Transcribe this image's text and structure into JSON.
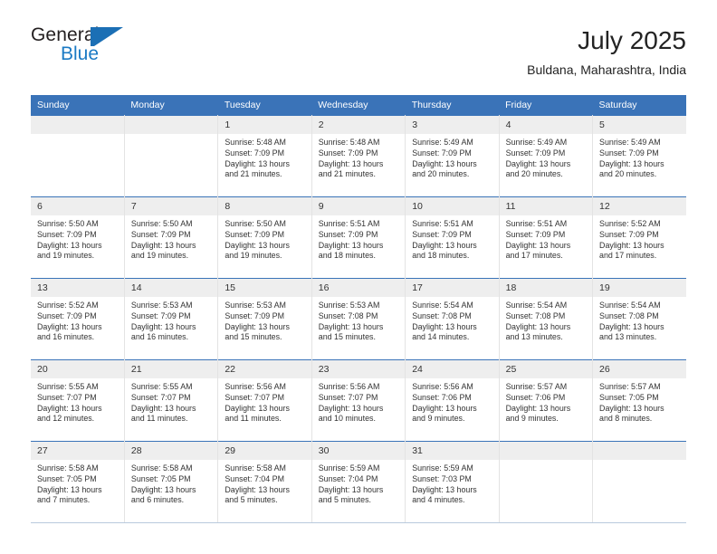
{
  "brand": {
    "line1": "General",
    "line2": "Blue",
    "flag_icon": "general-blue-flag-icon",
    "color_dark": "#1b6fb5",
    "color_light": "#1b7ac4"
  },
  "header": {
    "title": "July 2025",
    "subtitle": "Buldana, Maharashtra, India"
  },
  "theme": {
    "header_blue": "#3a73b8",
    "row_divider": "#3a73b8",
    "daynum_bg": "#eeeeee",
    "text": "#333333"
  },
  "weekdays": [
    "Sunday",
    "Monday",
    "Tuesday",
    "Wednesday",
    "Thursday",
    "Friday",
    "Saturday"
  ],
  "weeks": [
    [
      {
        "day": "",
        "sunrise": "",
        "sunset": "",
        "daylight1": "",
        "daylight2": ""
      },
      {
        "day": "",
        "sunrise": "",
        "sunset": "",
        "daylight1": "",
        "daylight2": ""
      },
      {
        "day": "1",
        "sunrise": "Sunrise: 5:48 AM",
        "sunset": "Sunset: 7:09 PM",
        "daylight1": "Daylight: 13 hours",
        "daylight2": "and 21 minutes."
      },
      {
        "day": "2",
        "sunrise": "Sunrise: 5:48 AM",
        "sunset": "Sunset: 7:09 PM",
        "daylight1": "Daylight: 13 hours",
        "daylight2": "and 21 minutes."
      },
      {
        "day": "3",
        "sunrise": "Sunrise: 5:49 AM",
        "sunset": "Sunset: 7:09 PM",
        "daylight1": "Daylight: 13 hours",
        "daylight2": "and 20 minutes."
      },
      {
        "day": "4",
        "sunrise": "Sunrise: 5:49 AM",
        "sunset": "Sunset: 7:09 PM",
        "daylight1": "Daylight: 13 hours",
        "daylight2": "and 20 minutes."
      },
      {
        "day": "5",
        "sunrise": "Sunrise: 5:49 AM",
        "sunset": "Sunset: 7:09 PM",
        "daylight1": "Daylight: 13 hours",
        "daylight2": "and 20 minutes."
      }
    ],
    [
      {
        "day": "6",
        "sunrise": "Sunrise: 5:50 AM",
        "sunset": "Sunset: 7:09 PM",
        "daylight1": "Daylight: 13 hours",
        "daylight2": "and 19 minutes."
      },
      {
        "day": "7",
        "sunrise": "Sunrise: 5:50 AM",
        "sunset": "Sunset: 7:09 PM",
        "daylight1": "Daylight: 13 hours",
        "daylight2": "and 19 minutes."
      },
      {
        "day": "8",
        "sunrise": "Sunrise: 5:50 AM",
        "sunset": "Sunset: 7:09 PM",
        "daylight1": "Daylight: 13 hours",
        "daylight2": "and 19 minutes."
      },
      {
        "day": "9",
        "sunrise": "Sunrise: 5:51 AM",
        "sunset": "Sunset: 7:09 PM",
        "daylight1": "Daylight: 13 hours",
        "daylight2": "and 18 minutes."
      },
      {
        "day": "10",
        "sunrise": "Sunrise: 5:51 AM",
        "sunset": "Sunset: 7:09 PM",
        "daylight1": "Daylight: 13 hours",
        "daylight2": "and 18 minutes."
      },
      {
        "day": "11",
        "sunrise": "Sunrise: 5:51 AM",
        "sunset": "Sunset: 7:09 PM",
        "daylight1": "Daylight: 13 hours",
        "daylight2": "and 17 minutes."
      },
      {
        "day": "12",
        "sunrise": "Sunrise: 5:52 AM",
        "sunset": "Sunset: 7:09 PM",
        "daylight1": "Daylight: 13 hours",
        "daylight2": "and 17 minutes."
      }
    ],
    [
      {
        "day": "13",
        "sunrise": "Sunrise: 5:52 AM",
        "sunset": "Sunset: 7:09 PM",
        "daylight1": "Daylight: 13 hours",
        "daylight2": "and 16 minutes."
      },
      {
        "day": "14",
        "sunrise": "Sunrise: 5:53 AM",
        "sunset": "Sunset: 7:09 PM",
        "daylight1": "Daylight: 13 hours",
        "daylight2": "and 16 minutes."
      },
      {
        "day": "15",
        "sunrise": "Sunrise: 5:53 AM",
        "sunset": "Sunset: 7:09 PM",
        "daylight1": "Daylight: 13 hours",
        "daylight2": "and 15 minutes."
      },
      {
        "day": "16",
        "sunrise": "Sunrise: 5:53 AM",
        "sunset": "Sunset: 7:08 PM",
        "daylight1": "Daylight: 13 hours",
        "daylight2": "and 15 minutes."
      },
      {
        "day": "17",
        "sunrise": "Sunrise: 5:54 AM",
        "sunset": "Sunset: 7:08 PM",
        "daylight1": "Daylight: 13 hours",
        "daylight2": "and 14 minutes."
      },
      {
        "day": "18",
        "sunrise": "Sunrise: 5:54 AM",
        "sunset": "Sunset: 7:08 PM",
        "daylight1": "Daylight: 13 hours",
        "daylight2": "and 13 minutes."
      },
      {
        "day": "19",
        "sunrise": "Sunrise: 5:54 AM",
        "sunset": "Sunset: 7:08 PM",
        "daylight1": "Daylight: 13 hours",
        "daylight2": "and 13 minutes."
      }
    ],
    [
      {
        "day": "20",
        "sunrise": "Sunrise: 5:55 AM",
        "sunset": "Sunset: 7:07 PM",
        "daylight1": "Daylight: 13 hours",
        "daylight2": "and 12 minutes."
      },
      {
        "day": "21",
        "sunrise": "Sunrise: 5:55 AM",
        "sunset": "Sunset: 7:07 PM",
        "daylight1": "Daylight: 13 hours",
        "daylight2": "and 11 minutes."
      },
      {
        "day": "22",
        "sunrise": "Sunrise: 5:56 AM",
        "sunset": "Sunset: 7:07 PM",
        "daylight1": "Daylight: 13 hours",
        "daylight2": "and 11 minutes."
      },
      {
        "day": "23",
        "sunrise": "Sunrise: 5:56 AM",
        "sunset": "Sunset: 7:07 PM",
        "daylight1": "Daylight: 13 hours",
        "daylight2": "and 10 minutes."
      },
      {
        "day": "24",
        "sunrise": "Sunrise: 5:56 AM",
        "sunset": "Sunset: 7:06 PM",
        "daylight1": "Daylight: 13 hours",
        "daylight2": "and 9 minutes."
      },
      {
        "day": "25",
        "sunrise": "Sunrise: 5:57 AM",
        "sunset": "Sunset: 7:06 PM",
        "daylight1": "Daylight: 13 hours",
        "daylight2": "and 9 minutes."
      },
      {
        "day": "26",
        "sunrise": "Sunrise: 5:57 AM",
        "sunset": "Sunset: 7:05 PM",
        "daylight1": "Daylight: 13 hours",
        "daylight2": "and 8 minutes."
      }
    ],
    [
      {
        "day": "27",
        "sunrise": "Sunrise: 5:58 AM",
        "sunset": "Sunset: 7:05 PM",
        "daylight1": "Daylight: 13 hours",
        "daylight2": "and 7 minutes."
      },
      {
        "day": "28",
        "sunrise": "Sunrise: 5:58 AM",
        "sunset": "Sunset: 7:05 PM",
        "daylight1": "Daylight: 13 hours",
        "daylight2": "and 6 minutes."
      },
      {
        "day": "29",
        "sunrise": "Sunrise: 5:58 AM",
        "sunset": "Sunset: 7:04 PM",
        "daylight1": "Daylight: 13 hours",
        "daylight2": "and 5 minutes."
      },
      {
        "day": "30",
        "sunrise": "Sunrise: 5:59 AM",
        "sunset": "Sunset: 7:04 PM",
        "daylight1": "Daylight: 13 hours",
        "daylight2": "and 5 minutes."
      },
      {
        "day": "31",
        "sunrise": "Sunrise: 5:59 AM",
        "sunset": "Sunset: 7:03 PM",
        "daylight1": "Daylight: 13 hours",
        "daylight2": "and 4 minutes."
      },
      {
        "day": "",
        "sunrise": "",
        "sunset": "",
        "daylight1": "",
        "daylight2": ""
      },
      {
        "day": "",
        "sunrise": "",
        "sunset": "",
        "daylight1": "",
        "daylight2": ""
      }
    ]
  ]
}
